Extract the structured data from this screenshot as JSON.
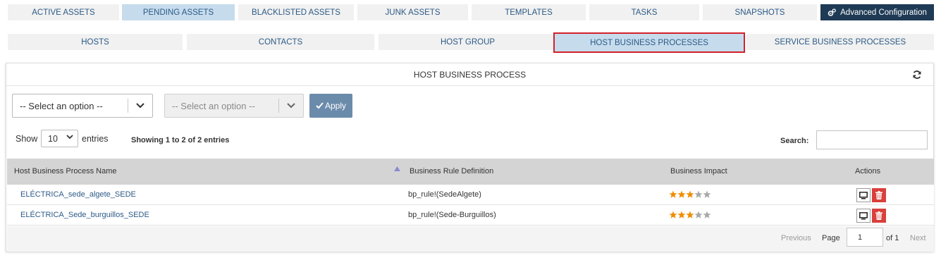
{
  "top_tabs": [
    {
      "label": "ACTIVE ASSETS"
    },
    {
      "label": "PENDING ASSETS"
    },
    {
      "label": "BLACKLISTED ASSETS"
    },
    {
      "label": "JUNK ASSETS"
    },
    {
      "label": "TEMPLATES"
    },
    {
      "label": "TASKS"
    },
    {
      "label": "SNAPSHOTS"
    },
    {
      "label": "Advanced Configuration",
      "icon": "gears-icon"
    }
  ],
  "sub_tabs": [
    {
      "label": "HOSTS"
    },
    {
      "label": "CONTACTS"
    },
    {
      "label": "HOST GROUP"
    },
    {
      "label": "HOST BUSINESS PROCESSES"
    },
    {
      "label": "SERVICE BUSINESS PROCESSES"
    }
  ],
  "panel": {
    "title": "HOST BUSINESS PROCESS",
    "refresh_icon": "refresh-icon"
  },
  "filters": {
    "select1": "-- Select an option --",
    "select2": "-- Select an option --",
    "apply_label": "Apply"
  },
  "table_controls": {
    "show_label": "Show",
    "length_value": "10",
    "entries_label": "entries",
    "info": "Showing 1 to 2 of 2 entries",
    "search_label": "Search:"
  },
  "table": {
    "headers": [
      "Host Business Process Name",
      "Business Rule Definition",
      "Business Impact",
      "Actions"
    ],
    "rows": [
      {
        "name": "ELÉCTRICA_sede_algete_SEDE",
        "rule": "bp_rule!(SedeAlgete)",
        "impact": 3
      },
      {
        "name": "ELÉCTRICA_Sede_burguillos_SEDE",
        "rule": "bp_rule!(Sede-Burguillos)",
        "impact": 3
      }
    ],
    "impact_max": 5
  },
  "pagination": {
    "previous": "Previous",
    "page_label": "Page",
    "page_value": "1",
    "of_label": "of 1",
    "next": "Next"
  },
  "colors": {
    "accent": "#2c5a86",
    "active_tab": "#c6dced",
    "dark_tab": "#1e3a55",
    "highlight_border": "#d2202b",
    "star_on": "#f08c00",
    "star_off": "#a8a8a8",
    "delete": "#d9403c"
  }
}
